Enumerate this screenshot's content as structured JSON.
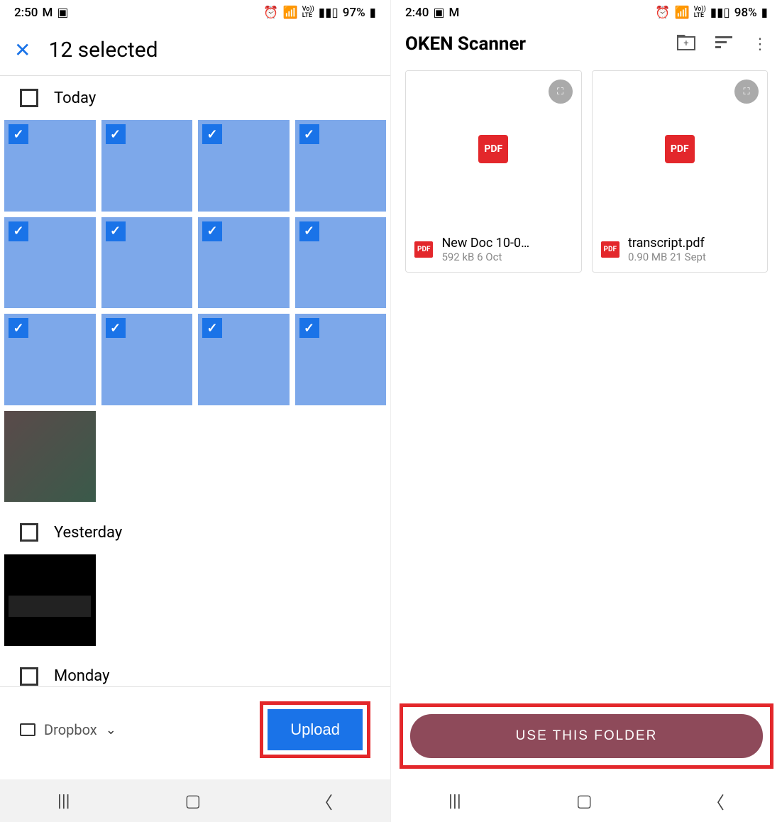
{
  "left": {
    "status": {
      "time": "2:50",
      "battery": "97%"
    },
    "header": {
      "title": "12 selected"
    },
    "sections": [
      "Today",
      "Yesterday",
      "Monday"
    ],
    "destination": "Dropbox",
    "upload_label": "Upload"
  },
  "right": {
    "status": {
      "time": "2:40",
      "battery": "98%"
    },
    "app_title": "OKEN Scanner",
    "docs": [
      {
        "name": "New Doc 10-0…",
        "size": "592 kB",
        "date": "6 Oct"
      },
      {
        "name": "transcript.pdf",
        "size": "0.90 MB",
        "date": "21 Sept"
      }
    ],
    "action_label": "USE THIS FOLDER"
  },
  "badges": {
    "pdf": "PDF"
  }
}
